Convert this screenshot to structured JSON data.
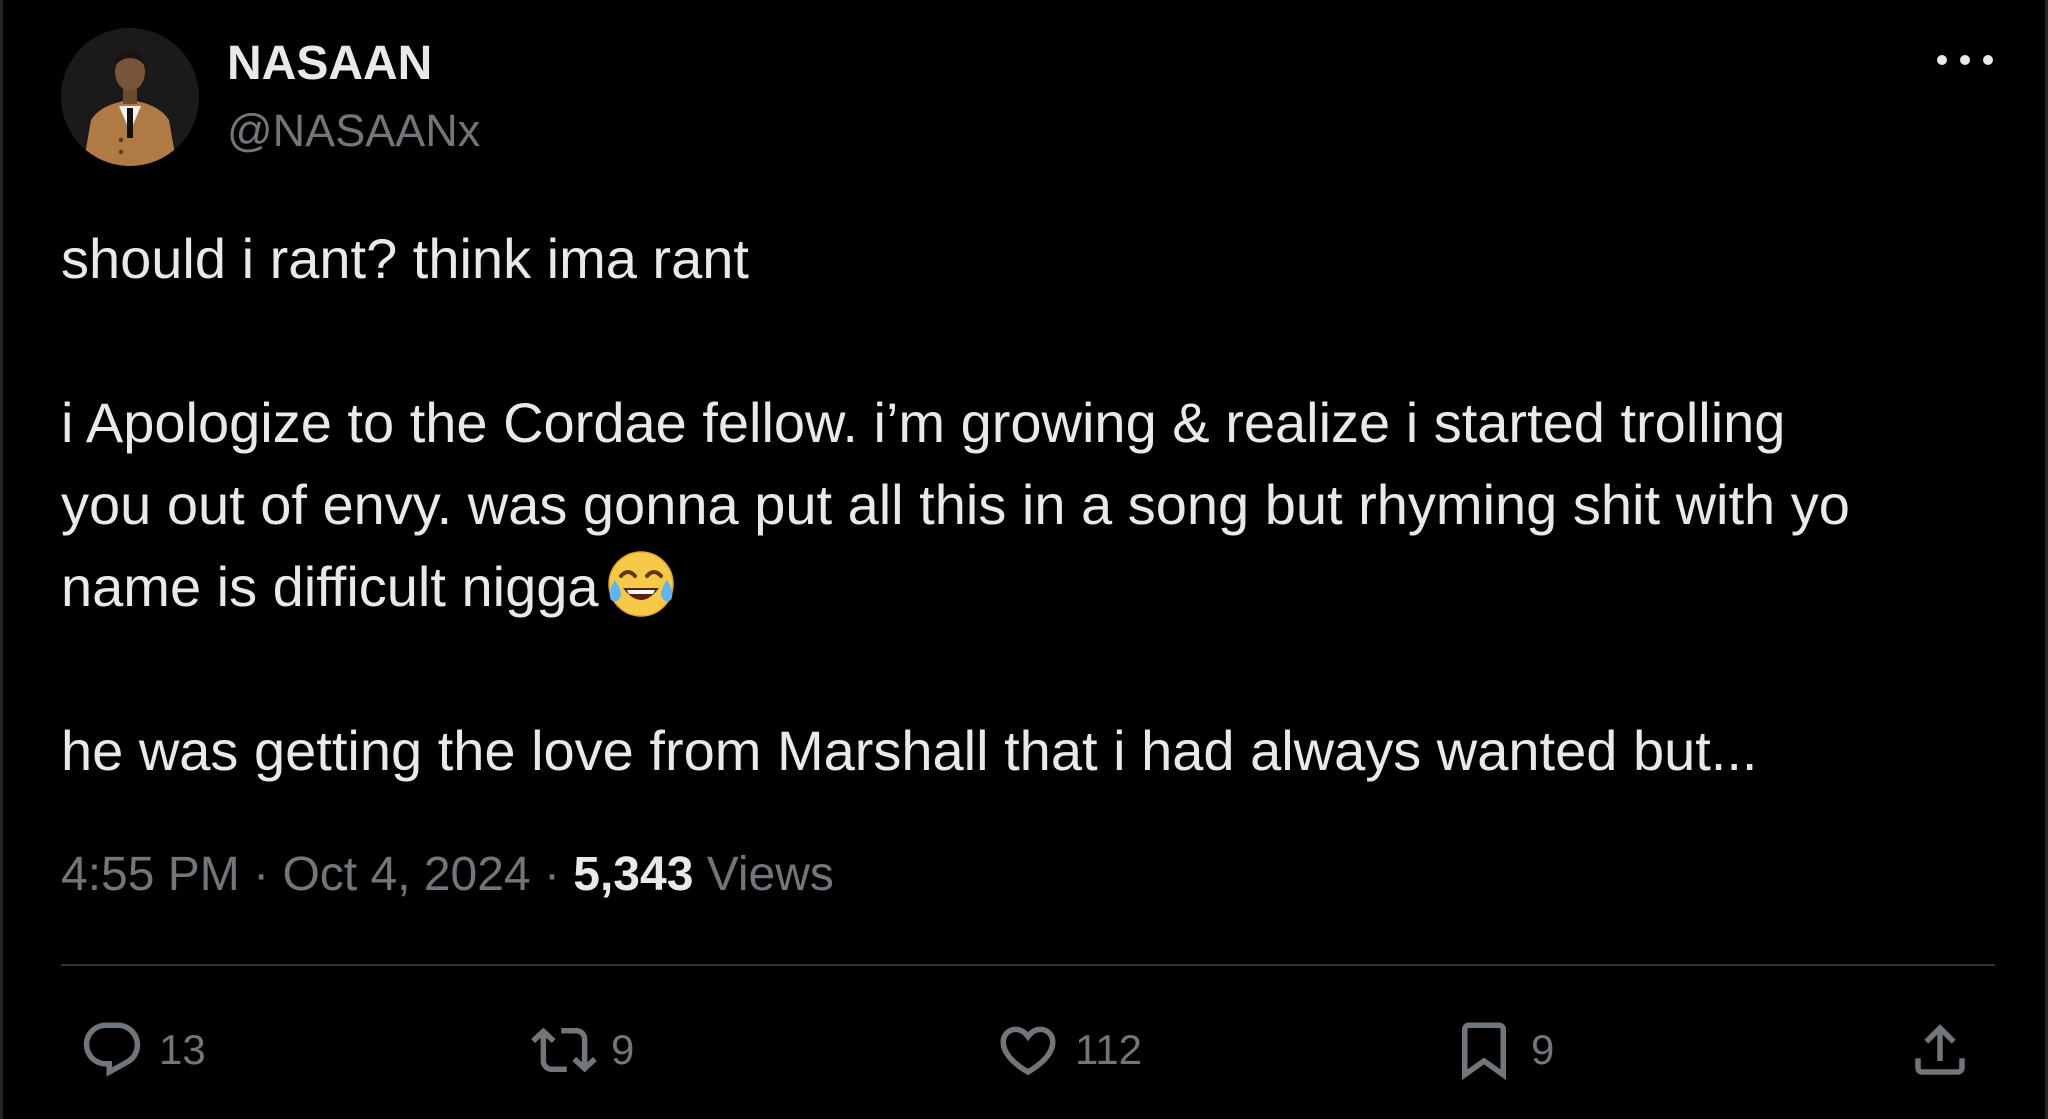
{
  "tweet": {
    "display_name": "NASAAN",
    "handle": "@NASAANx",
    "paragraphs": [
      [
        "should i rant? think ima rant"
      ],
      [
        "i Apologize to the Cordae fellow. i’m growing & realize i started trolling",
        "you out of envy. was gonna put all this in a song but rhyming shit with yo",
        "name is difficult nigga"
      ],
      [
        "he was getting the love from Marshall that i had always wanted but..."
      ]
    ],
    "emoji": "face-with-tears-of-joy",
    "time": "4:55 PM",
    "separator": "·",
    "date": "Oct 4, 2024",
    "views_count": "5,343",
    "views_label": "Views"
  },
  "actions": {
    "replies": "13",
    "retweets": "9",
    "likes": "112",
    "bookmarks": "9"
  },
  "icons": {
    "more": "more-horizontal-icon",
    "reply": "reply-bubble-icon",
    "retweet": "retweet-icon",
    "like": "heart-icon",
    "bookmark": "bookmark-icon",
    "share": "share-upload-icon"
  },
  "colors": {
    "background": "#000000",
    "text_primary": "#e7e9ea",
    "text_secondary": "#71767b",
    "divider": "#2f3336"
  }
}
